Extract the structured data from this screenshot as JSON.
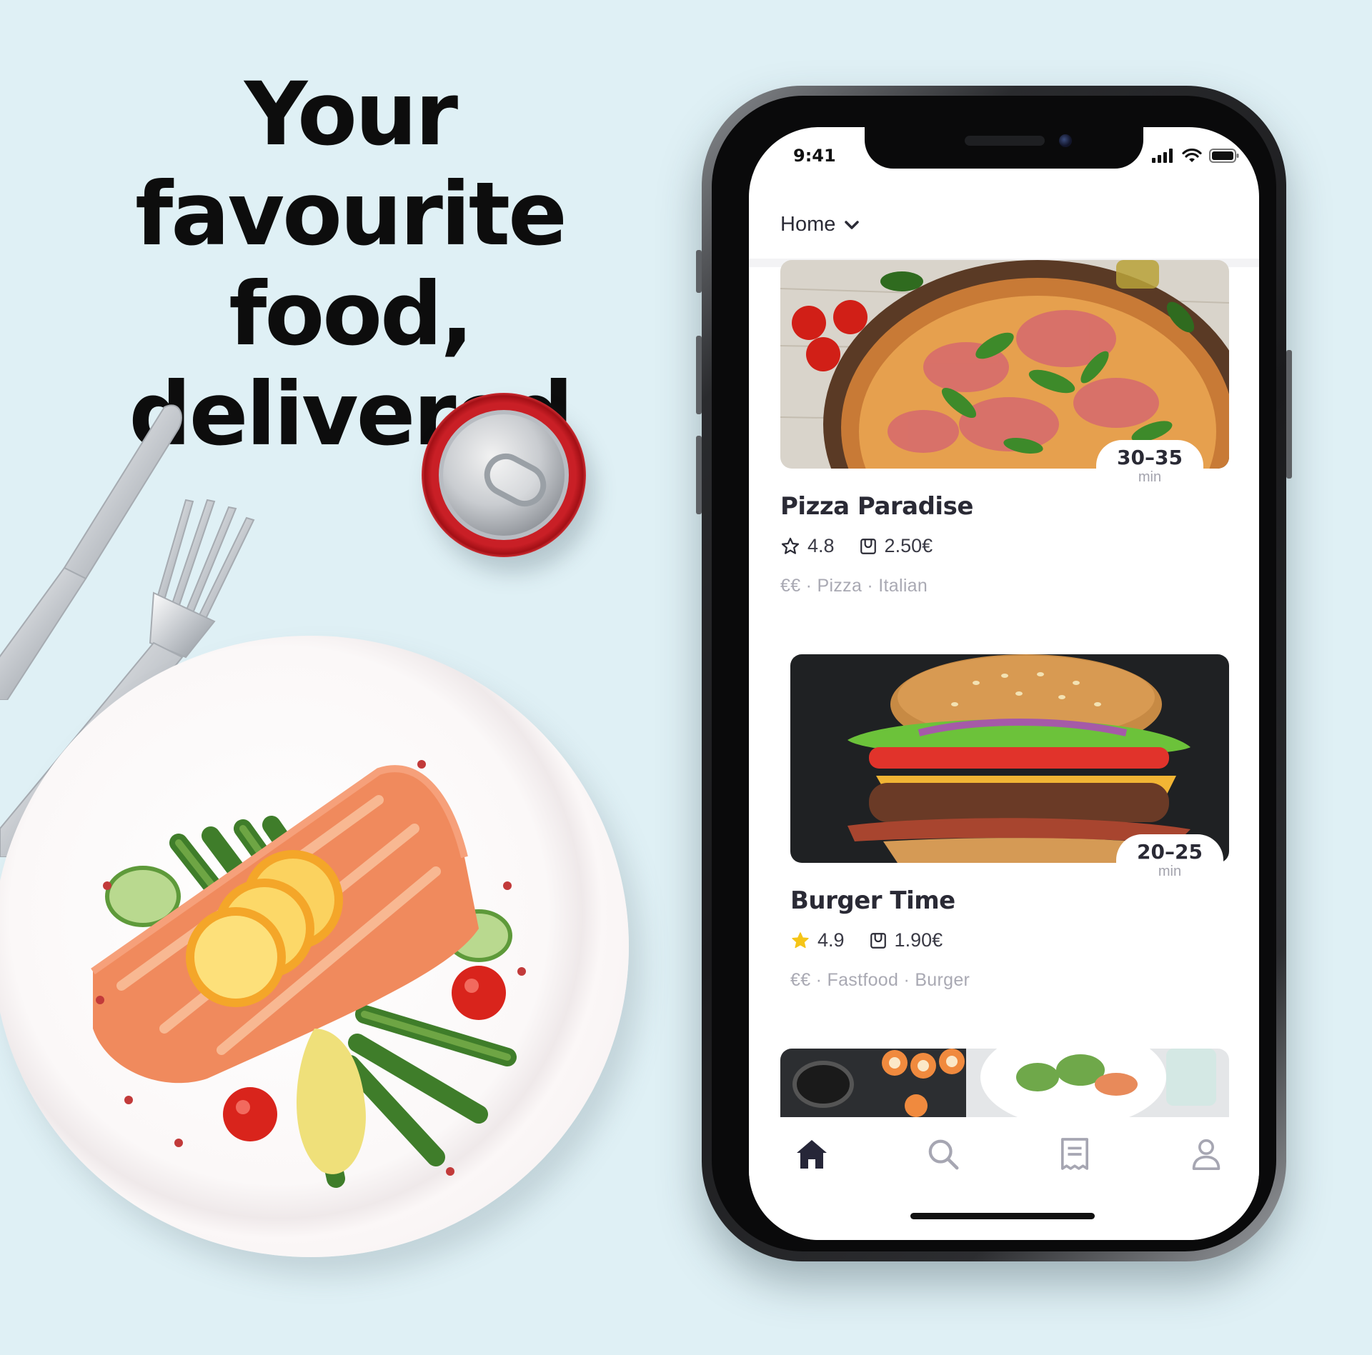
{
  "headline": {
    "line1": "Your favourite",
    "line2": "food, delivered"
  },
  "colors": {
    "background": "#dff0f5",
    "star_filled": "#f5c518",
    "text_dark": "#2a2a35",
    "text_muted": "#a9a9b3"
  },
  "status_bar": {
    "time": "9:41",
    "icons": [
      "signal-icon",
      "wifi-icon",
      "battery-icon"
    ]
  },
  "header": {
    "location": "Home",
    "dropdown_icon": "chevron-down-icon"
  },
  "restaurants": [
    {
      "name": "Pizza Paradise",
      "eta_range": "30–35",
      "eta_unit": "min",
      "rating": "4.8",
      "rating_icon": "star-outline-icon",
      "delivery_fee": "2.50€",
      "delivery_icon": "bag-icon",
      "tags": "€€ · Pizza · Italian",
      "image": "pizza-photo"
    },
    {
      "name": "Burger Time",
      "eta_range": "20–25",
      "eta_unit": "min",
      "rating": "4.9",
      "rating_icon": "star-filled-icon",
      "delivery_fee": "1.90€",
      "delivery_icon": "bag-icon",
      "tags": "€€ · Fastfood · Burger",
      "image": "burger-photo"
    },
    {
      "image": "sushi-photo"
    }
  ],
  "tab_bar": [
    {
      "icon": "home-icon",
      "active": true
    },
    {
      "icon": "search-icon",
      "active": false
    },
    {
      "icon": "receipt-icon",
      "active": false
    },
    {
      "icon": "profile-icon",
      "active": false
    }
  ]
}
